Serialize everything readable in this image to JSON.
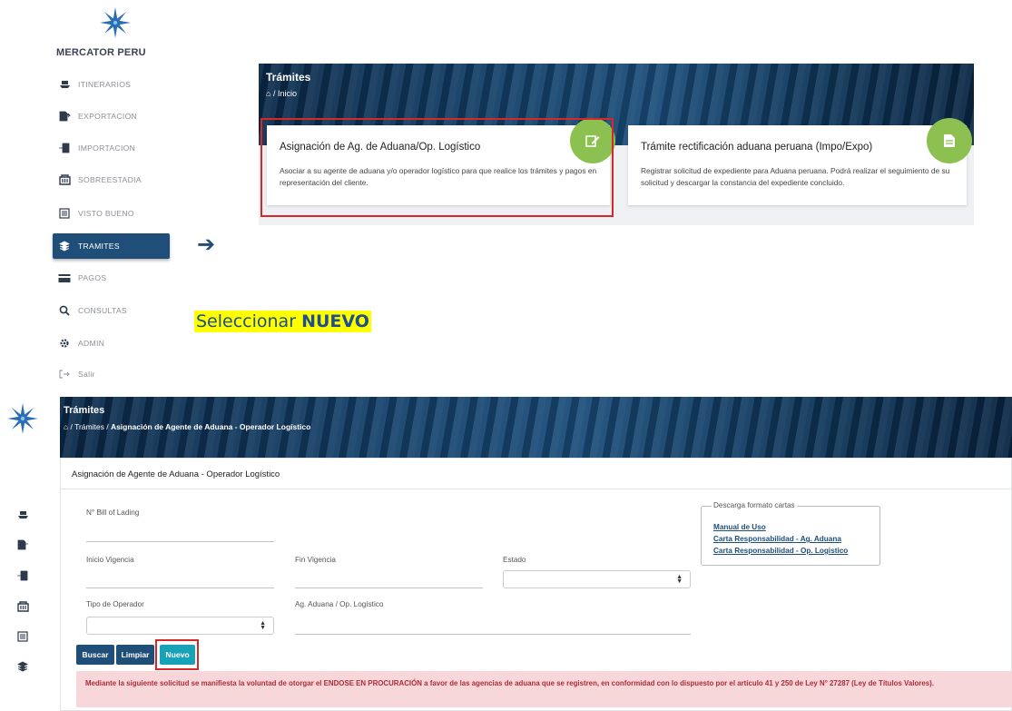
{
  "brand": {
    "name": "MERCATOR PERU"
  },
  "sidebar": {
    "items": [
      {
        "label": "ITINERARIOS",
        "icon": "ship-icon"
      },
      {
        "label": "EXPORTACION",
        "icon": "export-icon"
      },
      {
        "label": "IMPORTACION",
        "icon": "import-icon"
      },
      {
        "label": "SOBREESTADIA",
        "icon": "container-icon"
      },
      {
        "label": "VISTO BUENO",
        "icon": "document-list-icon"
      },
      {
        "label": "TRAMITES",
        "icon": "layers-icon",
        "active": true
      },
      {
        "label": "PAGOS",
        "icon": "card-icon"
      },
      {
        "label": "CONSULTAS",
        "icon": "search-icon"
      },
      {
        "label": "ADMIN",
        "icon": "gear-icon"
      },
      {
        "label": "Salir",
        "icon": "logout-icon"
      }
    ]
  },
  "top_panel": {
    "title": "Trámites",
    "breadcrumb": "/ Inicio",
    "cards": [
      {
        "title": "Asignación de Ag. de Aduana/Op. Logístico",
        "description": "Asociar a su agente de aduana y/o operador logístico para que realice los trámites y pagos en representación del cliente.",
        "icon": "edit-icon"
      },
      {
        "title": "Trámite rectificación aduana peruana (Impo/Expo)",
        "description": "Registrar solicitud de expediente para Aduana peruana. Podrá realizar el seguimiento de su solicitud y descargar la constancia del expediente concluido.",
        "icon": "document-icon"
      }
    ]
  },
  "hint": {
    "prefix": "Seleccionar ",
    "bold": "NUEVO"
  },
  "bottom": {
    "title": "Trámites",
    "breadcrumb_prefix": "/ Trámites /",
    "breadcrumb_current": "Asignación de Agente de Aduana - Operador Logístico",
    "card_title": "Asignación de Agente de Aduana - Operador Logístico",
    "form": {
      "bill_of_lading_label": "N° Bill of Lading",
      "inicio_vigencia_label": "Inicio Vigencia",
      "fin_vigencia_label": "Fin Vigencia",
      "estado_label": "Estado",
      "tipo_operador_label": "Tipo de Operador",
      "ag_aduana_label": "Ag. Aduana / Op. Logístico"
    },
    "downloads": {
      "legend": "Descarga formato cartas",
      "links": [
        "Manual de Uso",
        "Carta Responsabilidad - Ag. Aduana",
        "Carta Responsabilidad - Op. Logistico"
      ]
    },
    "buttons": {
      "buscar": "Buscar",
      "limpiar": "Limpiar",
      "nuevo": "Nuevo"
    },
    "notice": "Mediante la siguiente solicitud se manifiesta la voluntad de otorgar el ENDOSE EN PROCURACIÓN a favor de las agencias de aduana que se registren, en conformidad con lo dispuesto por el artículo 41 y 250 de Ley N° 27287 (Ley de Títulos Valores)."
  },
  "colors": {
    "primary": "#1f4e79",
    "accent": "#17a2b8",
    "badge": "#8cc152",
    "highlight": "#d72828",
    "notice_bg": "#f8d7da"
  }
}
